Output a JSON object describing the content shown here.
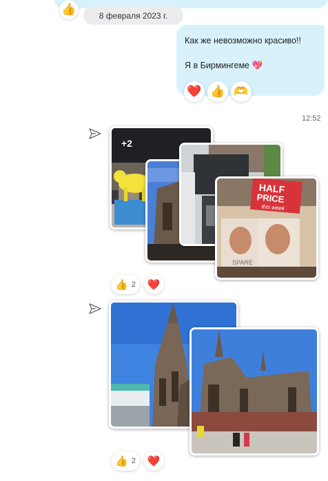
{
  "chat": {
    "top_reaction": "👍",
    "date_separator": "8 февраля 2023 г.",
    "outgoing_message": {
      "line1": "Как же невозможно красиво!!",
      "line2": "Я в Бирмингеме 💖",
      "reactions": [
        "❤️",
        "👍",
        "🫶"
      ]
    },
    "timestamp": "12:52",
    "album1": {
      "more_count": "+2",
      "reactions": [
        {
          "icon": "👍",
          "count": "2"
        },
        {
          "icon": "❤️",
          "count": ""
        }
      ]
    },
    "album2": {
      "reactions": [
        {
          "icon": "👍",
          "count": "2"
        },
        {
          "icon": "❤️",
          "count": ""
        }
      ]
    },
    "book_sign": {
      "line1": "HALF",
      "line2": "PRICE",
      "line3": "this week"
    },
    "book_title": "SPARE"
  },
  "colors": {
    "bubble": "#d8f2fb",
    "heart": "#e0245e",
    "thumb": "#f5b82e",
    "sky": "#3f83e0"
  }
}
